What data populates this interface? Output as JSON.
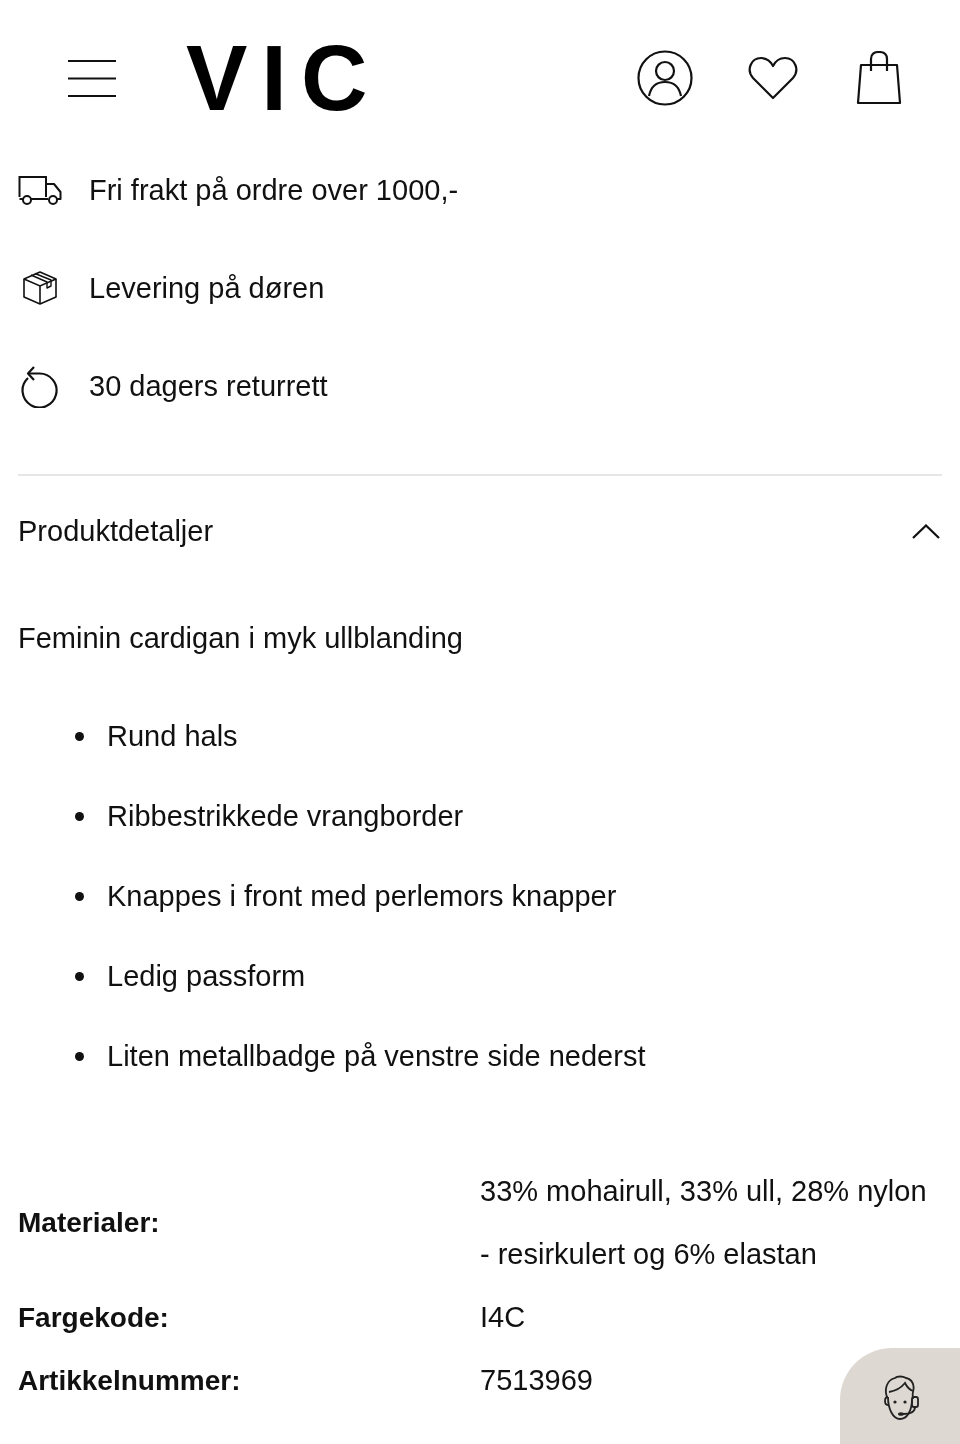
{
  "header": {
    "logo": "VIC"
  },
  "usps": [
    {
      "kind": "truck",
      "text": "Fri frakt på ordre over 1000,-"
    },
    {
      "kind": "box",
      "text": "Levering på døren"
    },
    {
      "kind": "return",
      "text": "30 dagers returrett"
    }
  ],
  "accordion": {
    "title": "Produktdetaljer",
    "expanded": true,
    "intro": "Feminin cardigan i myk ullblanding",
    "bullets": [
      "Rund hals",
      "Ribbestrikkede vrangborder",
      "Knappes i front med perlemors knapper",
      "Ledig passform",
      "Liten metallbadge på venstre side nederst"
    ],
    "details": [
      {
        "label": "Materialer:",
        "value": "33% mohairull, 33% ull, 28% nylon\n- resirkulert og 6% elastan"
      },
      {
        "label": "Fargekode:",
        "value": "I4C"
      },
      {
        "label": "Artikkelnummer:",
        "value": "7513969"
      }
    ]
  }
}
